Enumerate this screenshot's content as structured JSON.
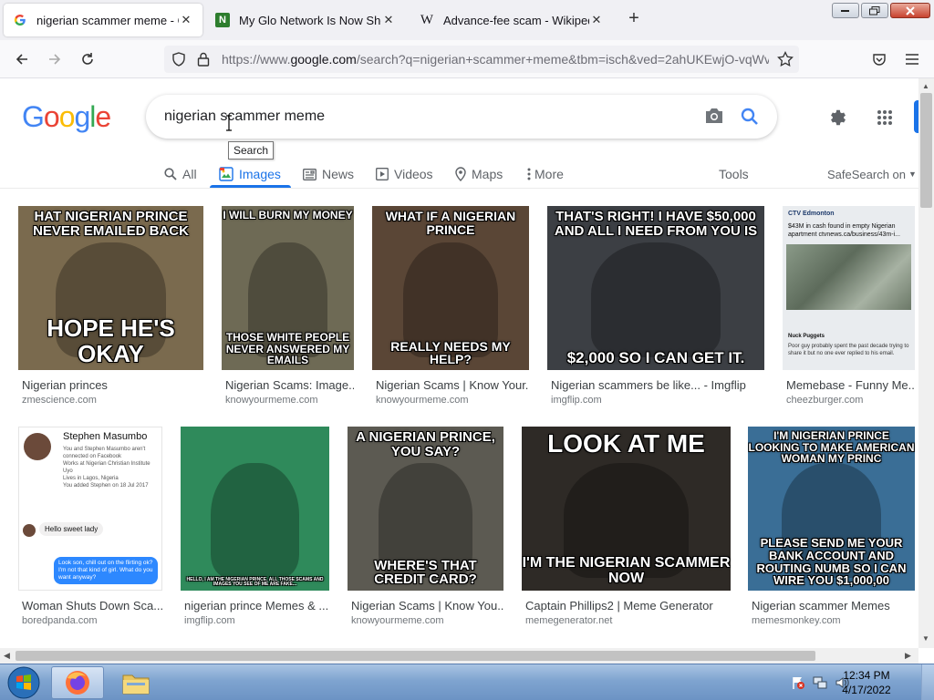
{
  "browser": {
    "tabs": [
      {
        "title": "nigerian scammer meme - Goo",
        "favicon": "google-g",
        "active": true
      },
      {
        "title": "My Glo Network Is Now Showin",
        "favicon": "nairaland-n",
        "active": false
      },
      {
        "title": "Advance-fee scam - Wikipedia",
        "favicon": "wikipedia-w",
        "active": false
      }
    ],
    "new_tab": "+",
    "url_scheme": "https://www.",
    "url_host": "google.com",
    "url_rest": "/search?q=nigerian+scammer+meme&tbm=isch&ved=2ahUKEwjO-vqWv"
  },
  "google": {
    "logo_letters": [
      {
        "ch": "G",
        "color": "#4285f4"
      },
      {
        "ch": "o",
        "color": "#ea4335"
      },
      {
        "ch": "o",
        "color": "#fbbc05"
      },
      {
        "ch": "g",
        "color": "#4285f4"
      },
      {
        "ch": "l",
        "color": "#34a853"
      },
      {
        "ch": "e",
        "color": "#ea4335"
      }
    ],
    "query": "nigerian scammer meme",
    "tooltip": "Search",
    "filters": {
      "all": "All",
      "images": "Images",
      "news": "News",
      "videos": "Videos",
      "maps": "Maps",
      "more": "More"
    },
    "tools": "Tools",
    "safesearch": "SafeSearch on"
  },
  "results": [
    {
      "caption": "Nigerian princes",
      "site": "zmescience.com",
      "top_text": "HAT NIGERIAN PRINCE NEVER EMAILED BACK",
      "bottom_text": "HOPE HE'S OKAY",
      "bg": "#7a6a4e"
    },
    {
      "caption": "Nigerian Scams: Image...",
      "site": "knowyourmeme.com",
      "top_text": "I WILL BURN MY MONEY",
      "bottom_text": "THOSE WHITE PEOPLE NEVER ANSWERED MY EMAILS",
      "bg": "#6e6a55"
    },
    {
      "caption": "Nigerian Scams | Know Your...",
      "site": "knowyourmeme.com",
      "top_text": "WHAT IF A NIGERIAN PRINCE",
      "bottom_text": "REALLY NEEDS MY HELP?",
      "bg": "#5a4636"
    },
    {
      "caption": "Nigerian scammers be like... - Imgflip",
      "site": "imgflip.com",
      "top_text": "THAT'S RIGHT! I HAVE $50,000 AND ALL I NEED FROM YOU IS",
      "bottom_text": "$2,000 SO I CAN GET IT.",
      "bg": "#3c3f44"
    },
    {
      "caption": "Memebase - Funny Me...",
      "site": "cheezburger.com",
      "top_text": "",
      "bottom_text": "",
      "bg": "#e9ecef",
      "tweet_header": "CTV Edmonton",
      "tweet_text": "$43M in cash found in empty Nigerian apartment ctvnews.ca/business/43m-i...",
      "tweet_reply": "Poor guy probably spent the past decade trying to share it but no one ever replied to his email.",
      "tweet_user": "Nuck Puggets"
    },
    {
      "caption": "Woman Shuts Down Sca...",
      "site": "boredpanda.com",
      "top_text": "",
      "bottom_text": "",
      "bg": "#ffffff",
      "profile_name": "Stephen Masumbo",
      "profile_lines": [
        "You and Stephen Masumbo aren't connected on Facebook",
        "Works at Nigerian Christian Institute Uyo",
        "Lives in Lagos, Nigeria",
        "You added Stephen on 18 Jul 2017"
      ],
      "msg_in": "Hello sweet lady",
      "msg_out": "Look son, chill out on the flirting ok? I'm not that kind of girl. What do you want anyway?"
    },
    {
      "caption": "nigerian prince Memes & ...",
      "site": "imgflip.com",
      "top_text": "",
      "bottom_text": "HELLO, I AM THE NIGERIAN PRINCE. ALL THOSE SCAMS AND IMAGES YOU SEE OF ME ARE FAKE...",
      "bg": "#2f8a5b"
    },
    {
      "caption": "Nigerian Scams | Know You...",
      "site": "knowyourmeme.com",
      "top_text": "A NIGERIAN PRINCE, YOU SAY?",
      "bottom_text": "WHERE'S THAT CREDIT CARD?",
      "bg": "#5c5a52"
    },
    {
      "caption": "Captain Phillips2 | Meme Generator",
      "site": "memegenerator.net",
      "top_text": "LOOK AT ME",
      "bottom_text": "I'M THE NIGERIAN SCAMMER NOW",
      "bg": "#2e2a26"
    },
    {
      "caption": "Nigerian scammer Memes",
      "site": "memesmonkey.com",
      "top_text": "I'M NIGERIAN PRINCE LOOKING TO MAKE AMERICAN WOMAN MY PRINC",
      "bottom_text": "PLEASE SEND ME YOUR BANK ACCOUNT AND ROUTING NUMB SO I CAN WIRE YOU $1,000,00",
      "bg": "#3a6e96"
    }
  ],
  "taskbar": {
    "time": "12:34 PM",
    "date": "4/17/2022"
  }
}
